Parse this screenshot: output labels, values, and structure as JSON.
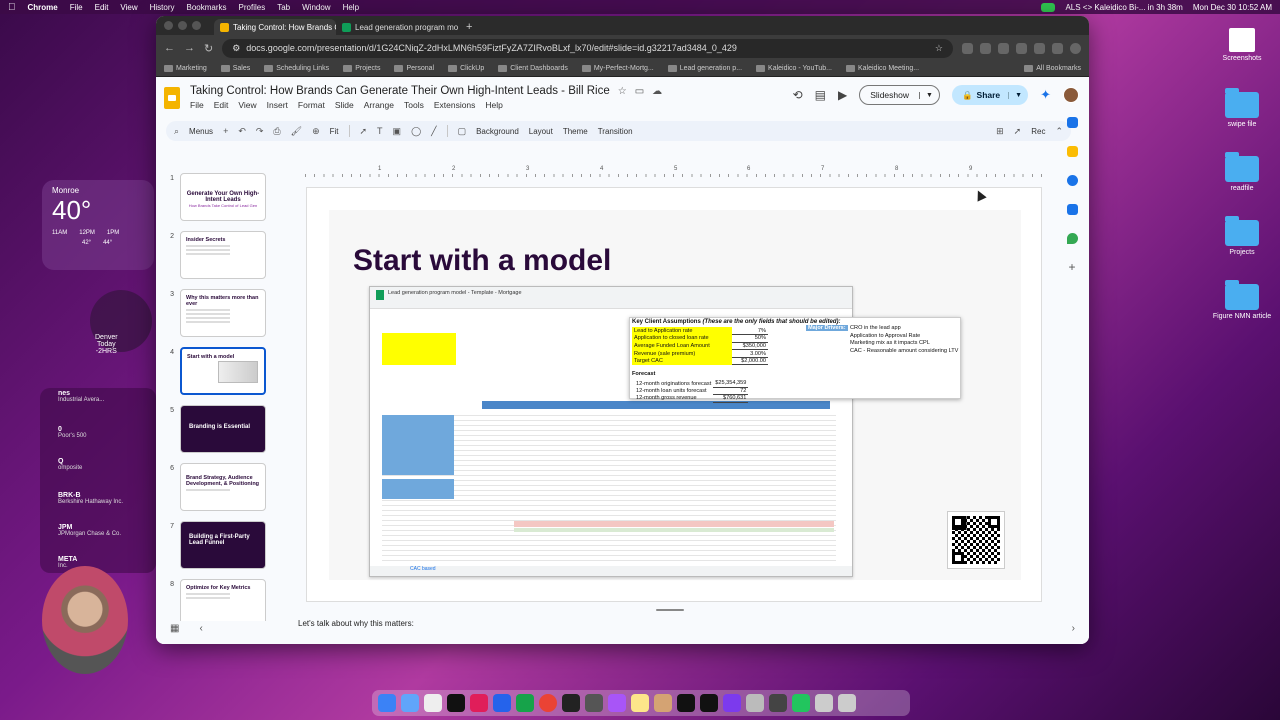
{
  "menubar": {
    "app": "Chrome",
    "items": [
      "File",
      "Edit",
      "View",
      "History",
      "Bookmarks",
      "Profiles",
      "Tab",
      "Window",
      "Help"
    ],
    "status_text": "ALS <> Kaleidico Bi-... in 3h 38m",
    "datetime": "Mon Dec 30  10:52 AM"
  },
  "browser": {
    "tabs": [
      {
        "title": "Taking Control: How Brands C",
        "favicon_color": "#f4b400"
      },
      {
        "title": "Lead generation program mo",
        "favicon_color": "#0f9d58"
      }
    ],
    "url": "docs.google.com/presentation/d/1G24CNiqZ-2dHxLMN6h59FiztFyZA7ZIRvoBLxf_lx70/edit#slide=id.g32217ad3484_0_429",
    "bookmarks": [
      "Marketing",
      "Sales",
      "Scheduling Links",
      "Projects",
      "Personal",
      "ClickUp",
      "Client Dashboards",
      "My-Perfect-Mortg...",
      "Lead generation p...",
      "Kaleidico - YouTub...",
      "Kaleidico Meeting..."
    ],
    "all_bookmarks": "All Bookmarks"
  },
  "doc": {
    "title": "Taking Control: How Brands Can Generate Their Own High-Intent Leads - Bill Rice",
    "menu": [
      "File",
      "Edit",
      "View",
      "Insert",
      "Format",
      "Slide",
      "Arrange",
      "Tools",
      "Extensions",
      "Help"
    ],
    "slideshow_label": "Slideshow",
    "share_label": "Share"
  },
  "toolbar": {
    "menus": "Menus",
    "zoom": "Fit",
    "background": "Background",
    "layout": "Layout",
    "theme": "Theme",
    "transition": "Transition",
    "rec": "Rec"
  },
  "ruler": [
    "1",
    "2",
    "3",
    "4",
    "5",
    "6",
    "7",
    "8",
    "9"
  ],
  "thumbnails": [
    {
      "num": "1",
      "title": "Generate Your Own High-Intent Leads",
      "subtitle": "How Brands Take Control of Lead Gen",
      "style": "light"
    },
    {
      "num": "2",
      "title": "Insider Secrets",
      "subtitle": "",
      "style": "light"
    },
    {
      "num": "3",
      "title": "Why this matters more than ever",
      "subtitle": "",
      "style": "light"
    },
    {
      "num": "4",
      "title": "Start with a model",
      "subtitle": "",
      "style": "active"
    },
    {
      "num": "5",
      "title": "Branding is Essential",
      "subtitle": "",
      "style": "dark"
    },
    {
      "num": "6",
      "title": "Brand Strategy, Audience Development, & Positioning",
      "subtitle": "",
      "style": "light"
    },
    {
      "num": "7",
      "title": "Building a First-Party Lead Funnel",
      "subtitle": "",
      "style": "dark"
    },
    {
      "num": "8",
      "title": "Optimize for Key Metrics",
      "subtitle": "",
      "style": "light"
    }
  ],
  "slide": {
    "title": "Start with a model",
    "sheet_title": "Lead generation program model - Template - Mortgage",
    "sheet_tab": "CAC based",
    "callout": {
      "heading": "Key Client Assumptions",
      "heading_note": "(These are the only fields that should be edited):",
      "rows": [
        {
          "label": "Lead to Application rate",
          "value": "7%"
        },
        {
          "label": "Application to closed loan rate",
          "value": "50%"
        },
        {
          "label": "Average Funded Loan Amount",
          "value": "$350,000"
        },
        {
          "label": "Revenue (sale premium)",
          "value": "3.00%"
        },
        {
          "label": "Target CAC",
          "value": "$2,000.00"
        }
      ],
      "forecast_heading": "Forecast",
      "forecast": [
        {
          "label": "12-month originations forecast",
          "value": "$25,354,359"
        },
        {
          "label": "12-month loan units forecast",
          "value": "72"
        },
        {
          "label": "12-month gross revenue",
          "value": "$760,631"
        }
      ],
      "drivers_heading": "Major Drivers:",
      "drivers": [
        "CRO in the lead app",
        "Application to Approval Rate",
        "Marketing mix as it impacts CPL",
        "CAC - Reasonable amount considering LTV"
      ]
    }
  },
  "notes": {
    "text": "Let's talk about why this matters:"
  },
  "desktop": {
    "icons": [
      "Screenshots",
      "swipe file",
      "readfile",
      "Projects",
      "Figure NMN article"
    ],
    "weather": {
      "city": "Monroe",
      "temp": "40°",
      "hours": [
        "11AM",
        "12PM",
        "1PM"
      ],
      "low_temps": [
        "42°",
        "44°"
      ]
    },
    "clock": {
      "city": "Denver",
      "day": "Today",
      "offset": "-2HRS"
    },
    "stocks": [
      {
        "ticker": "nes",
        "name": "Industrial Avera..."
      },
      {
        "ticker": "0",
        "name": "Poor's 500"
      },
      {
        "ticker": "Q",
        "name": "omposite"
      },
      {
        "ticker": "BRK-B",
        "name": "Berkshire Hathaway Inc."
      },
      {
        "ticker": "JPM",
        "name": "JPMorgan Chase & Co."
      },
      {
        "ticker": "META",
        "name": "Inc."
      }
    ]
  }
}
